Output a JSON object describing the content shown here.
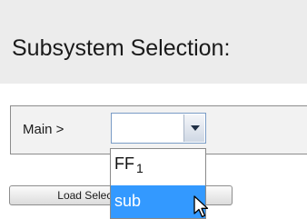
{
  "header": {
    "title": "Subsystem Selection:"
  },
  "breadcrumb": {
    "label": "Main >",
    "selector": {
      "value": "",
      "options": [
        {
          "label": "FF",
          "subscript": "1",
          "highlighted": false
        },
        {
          "label": "sub",
          "highlighted": true
        }
      ]
    }
  },
  "load_button": {
    "label": "Load Selected Subsystem"
  },
  "colors": {
    "highlight": "#3399ff",
    "header_bg": "#ececec"
  },
  "icons": {
    "dropdown": "chevron-down-icon",
    "pointer": "mouse-cursor-icon"
  }
}
